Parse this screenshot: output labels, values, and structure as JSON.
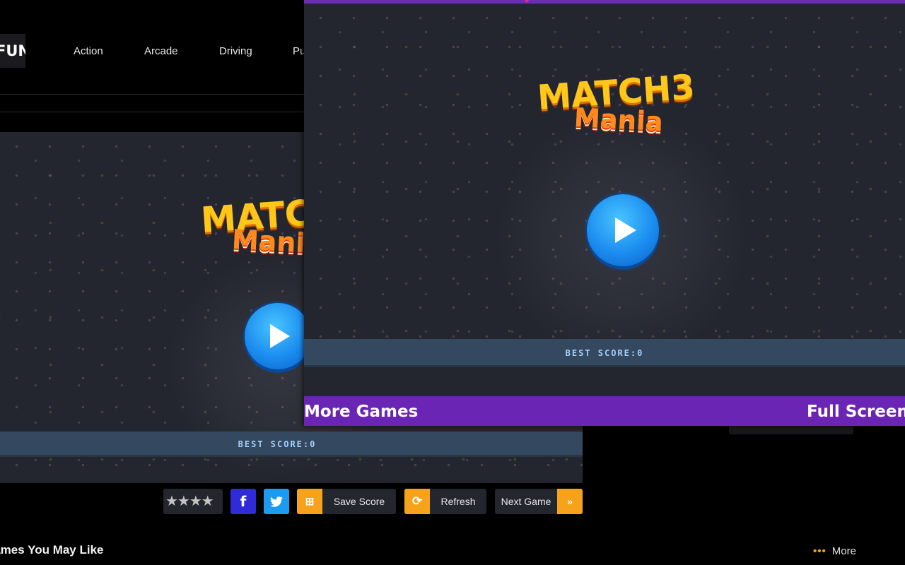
{
  "site": {
    "logo_text": "FUN",
    "nav": [
      "Action",
      "Arcade",
      "Driving",
      "Pu"
    ]
  },
  "game": {
    "title_line1": "MATCH3",
    "title_line2": "Mania",
    "best_score_label": "BEST SCORE:0"
  },
  "toolbar": {
    "stars": "★★★★",
    "facebook_glyph": "f",
    "save_score_label": "Save Score",
    "refresh_label": "Refresh",
    "next_game_label": "Next Game",
    "next_glyph": "»",
    "save_icon": "⊞",
    "refresh_icon": "⟳"
  },
  "overlay": {
    "more_games_label": "More Games",
    "full_screen_label": "Full Screen"
  },
  "footer": {
    "section_title": "Games You May Like",
    "more_label": "More",
    "more_dots": "•••"
  },
  "colors": {
    "purple_bar": "#6a25b5",
    "facebook": "#2f2bd6",
    "twitter": "#1d9bf0",
    "orange_accent": "#f7a21b",
    "score_bar": "#34495f"
  }
}
